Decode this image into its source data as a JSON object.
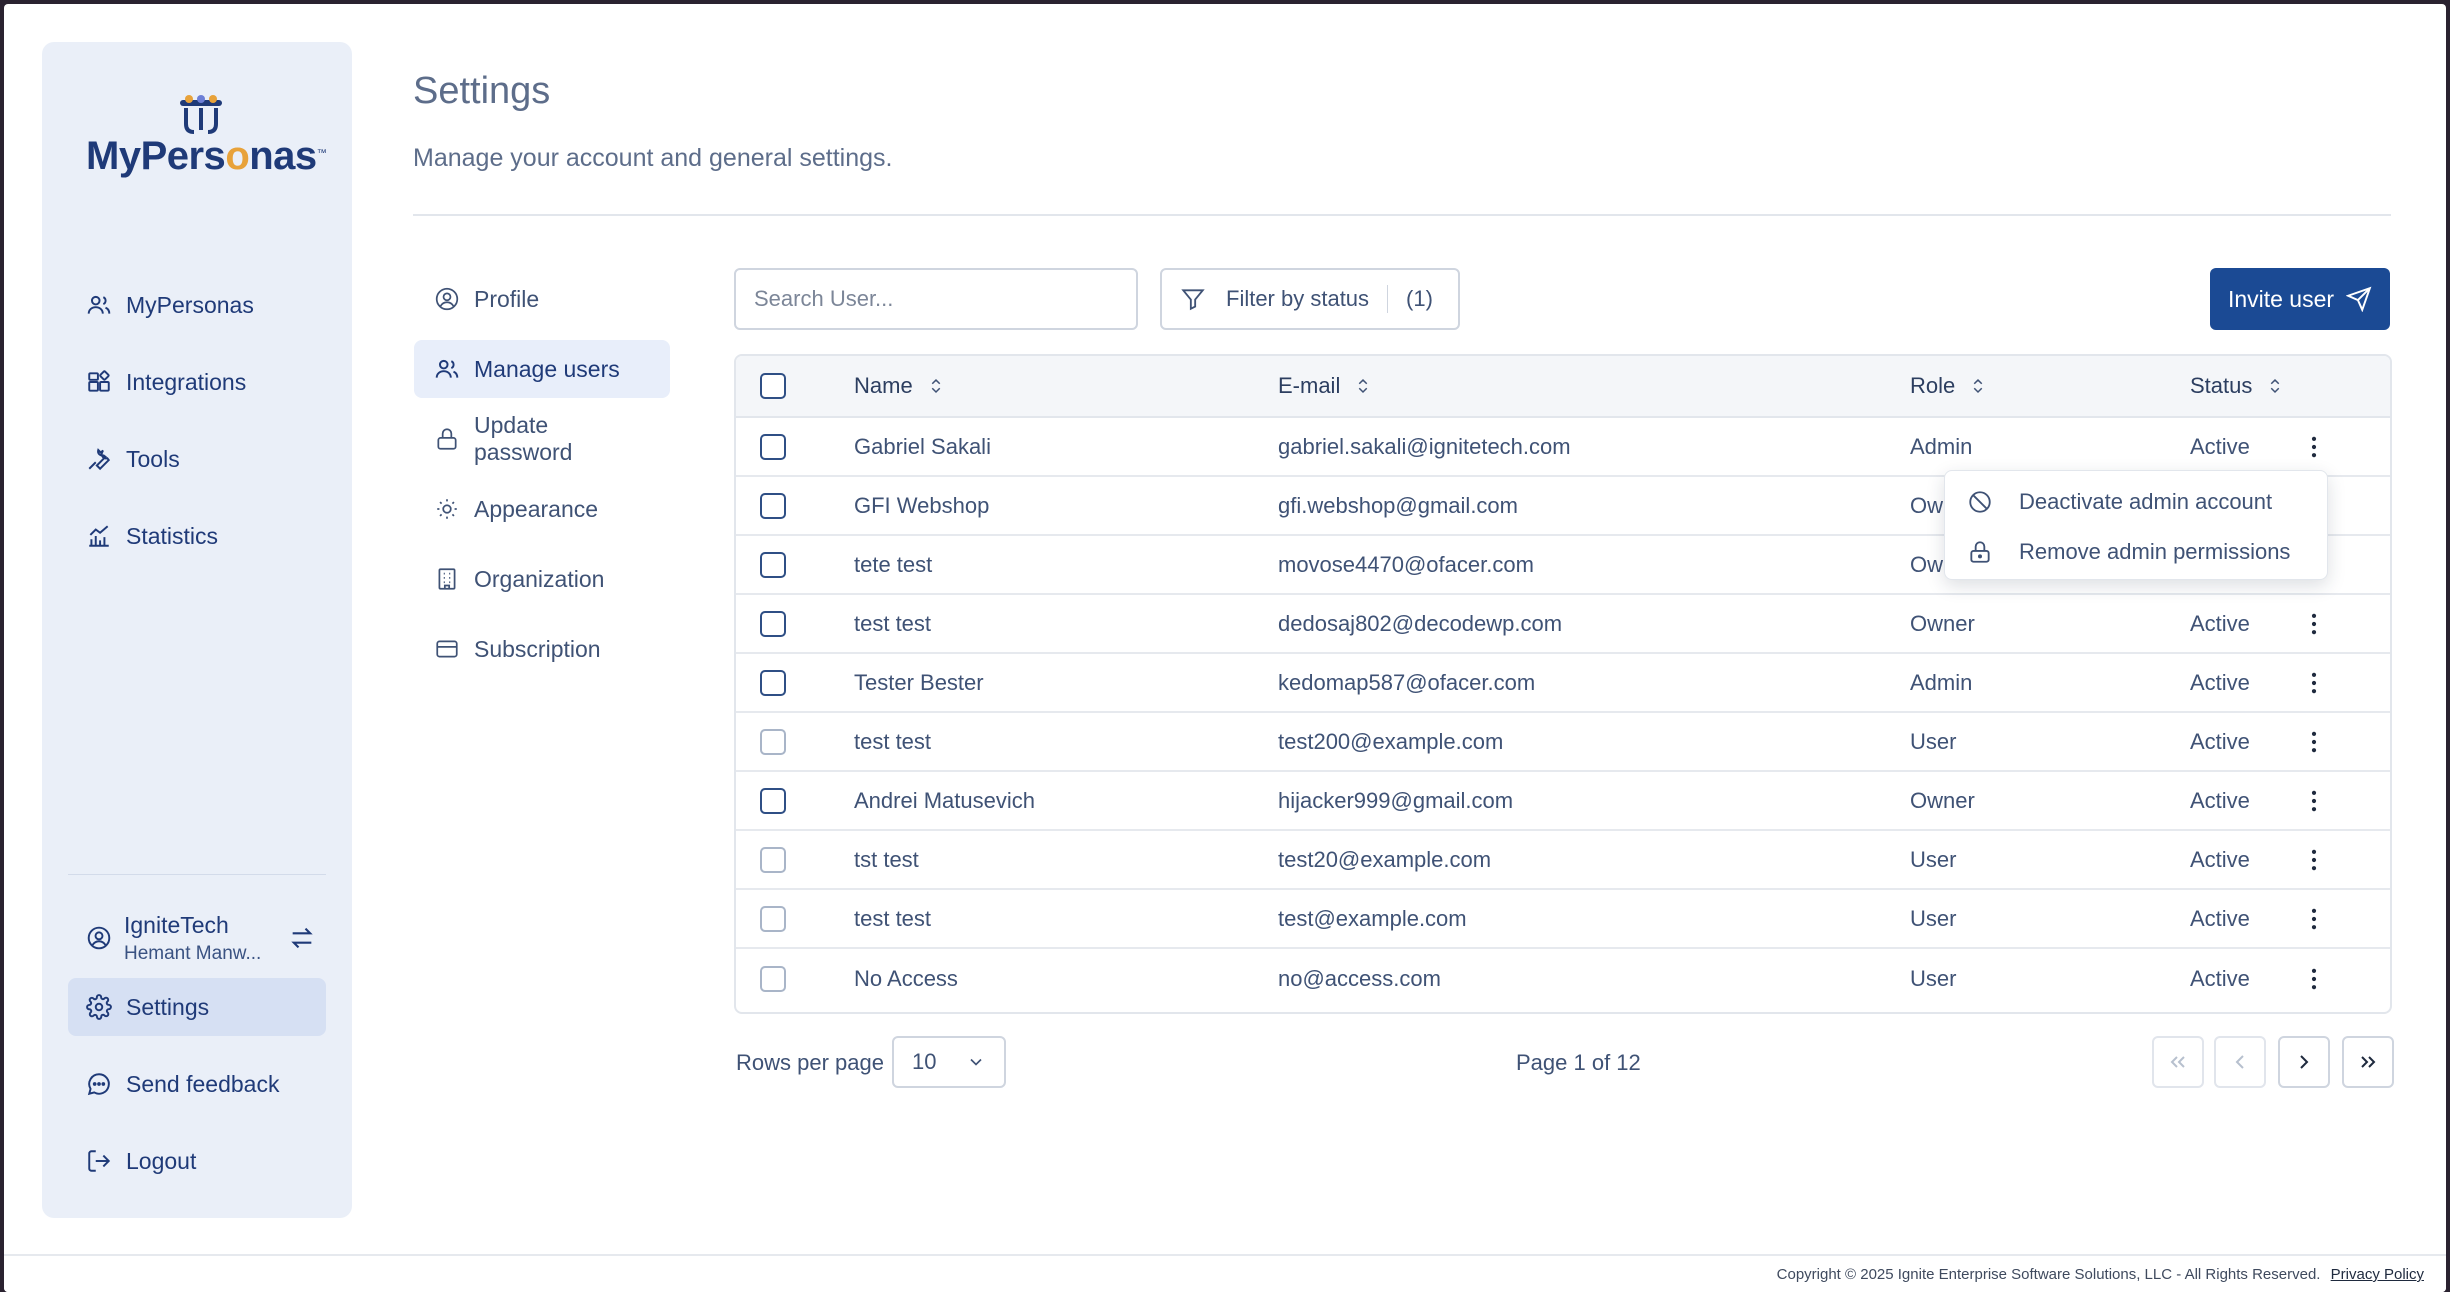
{
  "app": {
    "logo_text_a": "MyPers",
    "logo_text_o": "o",
    "logo_text_b": "nas",
    "logo_tm": "™"
  },
  "sidebar": {
    "items": [
      {
        "label": "MyPersonas",
        "icon": "users-icon"
      },
      {
        "label": "Integrations",
        "icon": "integrations-icon"
      },
      {
        "label": "Tools",
        "icon": "wrench-icon"
      },
      {
        "label": "Statistics",
        "icon": "chart-icon"
      }
    ],
    "org": {
      "name": "IgniteTech",
      "user": "Hemant Manw..."
    },
    "bottom_items": [
      {
        "label": "Settings",
        "icon": "gear-icon"
      },
      {
        "label": "Send feedback",
        "icon": "chat-icon"
      },
      {
        "label": "Logout",
        "icon": "logout-icon"
      }
    ]
  },
  "page": {
    "title": "Settings",
    "subtitle": "Manage your account and general settings."
  },
  "subnav": {
    "items": [
      {
        "label": "Profile"
      },
      {
        "label": "Manage users"
      },
      {
        "label": "Update password"
      },
      {
        "label": "Appearance"
      },
      {
        "label": "Organization"
      },
      {
        "label": "Subscription"
      }
    ]
  },
  "toolbar": {
    "search_placeholder": "Search User...",
    "filter_label": "Filter by status",
    "filter_count": "(1)",
    "invite_label": "Invite user"
  },
  "table": {
    "headers": {
      "name": "Name",
      "email": "E-mail",
      "role": "Role",
      "status": "Status"
    },
    "rows": [
      {
        "name": "Gabriel Sakali",
        "email": "gabriel.sakali@ignitetech.com",
        "role": "Admin",
        "status": "Active"
      },
      {
        "name": "GFI Webshop",
        "email": "gfi.webshop@gmail.com",
        "role": "Ow",
        "status": ""
      },
      {
        "name": "tete test",
        "email": "movose4470@ofacer.com",
        "role": "Ow",
        "status": ""
      },
      {
        "name": "test test",
        "email": "dedosaj802@decodewp.com",
        "role": "Owner",
        "status": "Active"
      },
      {
        "name": "Tester Bester",
        "email": "kedomap587@ofacer.com",
        "role": "Admin",
        "status": "Active"
      },
      {
        "name": "test test",
        "email": "test200@example.com",
        "role": "User",
        "status": "Active"
      },
      {
        "name": "Andrei Matusevich",
        "email": "hijacker999@gmail.com",
        "role": "Owner",
        "status": "Active"
      },
      {
        "name": "tst test",
        "email": "test20@example.com",
        "role": "User",
        "status": "Active"
      },
      {
        "name": "test test",
        "email": "test@example.com",
        "role": "User",
        "status": "Active"
      },
      {
        "name": "No Access",
        "email": "no@access.com",
        "role": "User",
        "status": "Active"
      }
    ]
  },
  "context_menu": {
    "items": [
      {
        "label": "Deactivate admin account",
        "icon": "ban-icon"
      },
      {
        "label": "Remove admin permissions",
        "icon": "lock-icon"
      }
    ]
  },
  "pagination": {
    "rows_per_page_label": "Rows per page",
    "rows_per_page_value": "10",
    "page_info": "Page 1 of 12"
  },
  "footer": {
    "copyright": "Copyright © 2025 Ignite Enterprise Software Solutions, LLC - All Rights Reserved.",
    "privacy_link": "Privacy Policy"
  },
  "colors": {
    "primary": "#1b4a94",
    "sidebar_bg": "#eaeff8",
    "accent_logo": "#e8a23a"
  }
}
